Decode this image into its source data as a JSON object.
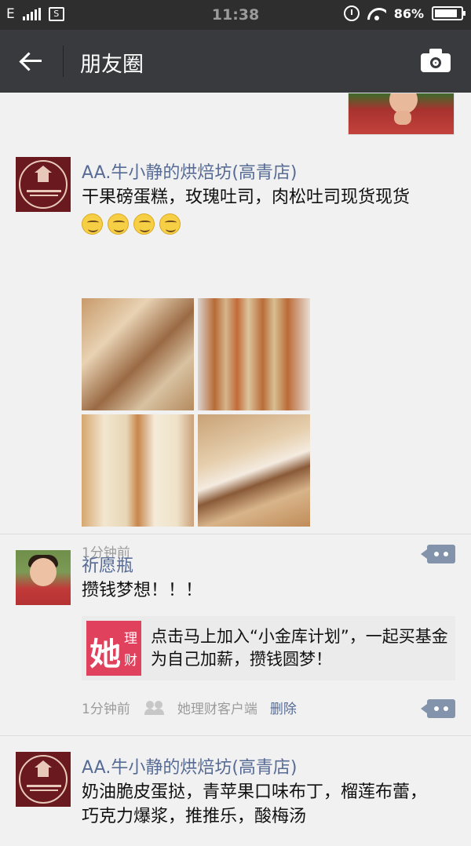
{
  "status_bar": {
    "network": "E",
    "sim_icon": "S",
    "time": "11:38",
    "battery_pct": "86%",
    "battery_level": 0.86
  },
  "nav": {
    "title": "朋友圈"
  },
  "posts": [
    {
      "name": "AA.牛小静的烘焙坊(高青店)",
      "text": "干果磅蛋糕，玫瑰吐司，肉松吐司现货现货",
      "emoji_count": 4,
      "time": "1分钟前"
    },
    {
      "name": "祈愿瓶",
      "text": "攒钱梦想！！！",
      "link": {
        "logo_big": "她",
        "logo_s1": "理",
        "logo_s2": "财",
        "text": "点击马上加入“小金库计划”，一起买基金为自己加薪，攒钱圆梦！"
      },
      "time": "1分钟前",
      "source": "她理财客户端",
      "delete_label": "删除"
    },
    {
      "name": "AA.牛小静的烘焙坊(高青店)",
      "text": "奶油脆皮蛋挞，青苹果口味布丁，榴莲布蕾，巧克力爆浆，推推乐，酸梅汤"
    }
  ]
}
